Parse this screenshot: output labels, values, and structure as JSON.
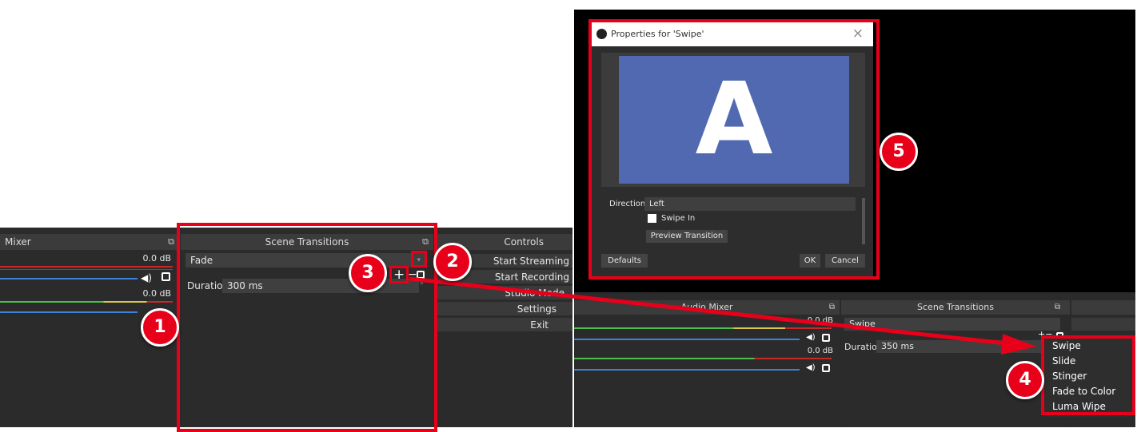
{
  "left": {
    "mixer": {
      "title": "Mixer",
      "track1_db": "0.0 dB",
      "track2_db": "0.0 dB"
    },
    "transitions": {
      "title": "Scene Transitions",
      "selected": "Fade",
      "duration_label": "Duration",
      "duration_value": "300 ms",
      "add_symbol": "+",
      "remove_symbol": "−"
    },
    "controls": {
      "title": "Controls",
      "buttons": [
        "Start Streaming",
        "Start Recording",
        "Studio Mode",
        "Settings",
        "Exit"
      ]
    }
  },
  "dialog": {
    "title": "Properties for 'Swipe'",
    "preview_letter": "A",
    "direction_label": "Direction",
    "direction_value": "Left",
    "swipe_in_label": "Swipe In",
    "preview_button": "Preview Transition",
    "defaults_button": "Defaults",
    "ok_button": "OK",
    "cancel_button": "Cancel",
    "close_symbol": "×"
  },
  "right": {
    "mixer": {
      "title": "Audio Mixer",
      "track1_db": "0.0 dB",
      "track2_db": "0.0 dB"
    },
    "transitions": {
      "title": "Scene Transitions",
      "selected": "Swipe",
      "duration_label": "Duration",
      "duration_value": "350 ms"
    },
    "menu_items": [
      "Swipe",
      "Slide",
      "Stinger",
      "Fade to Color",
      "Luma Wipe"
    ]
  },
  "badges": [
    "1",
    "2",
    "3",
    "4",
    "5"
  ],
  "colors": {
    "annotation_red": "#e8001a",
    "preview_blue": "#5069b0",
    "obs_panel": "#2b2b2b",
    "obs_title": "#3b3b3b"
  }
}
